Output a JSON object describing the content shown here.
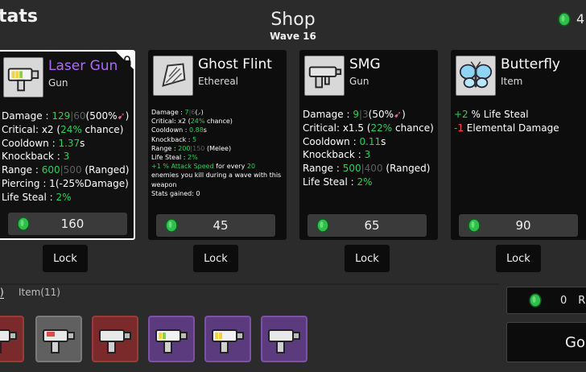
{
  "header": {
    "stats_label": "tats",
    "title": "Shop",
    "wave": "Wave 16",
    "coins": "4"
  },
  "colors": {
    "background": "#2b2b2b",
    "card": "#0d0d0d",
    "stat_green": "#29d05a",
    "stat_red": "#ff4a4a",
    "legendary_name": "#b366ff",
    "coin": "#2fbf4a"
  },
  "cards": [
    {
      "name": "Laser Gun",
      "type": "Gun",
      "icon": "laser-gun-icon",
      "selected": true,
      "locked": true,
      "price": "160",
      "lock_label": "Lock",
      "stats": {
        "damage_label": "Damage : ",
        "damage_value": "129",
        "damage_sep": "|",
        "damage_base": "60",
        "damage_scale": "(500%",
        "damage_scale_close": ")",
        "critical_label": "Critical: x2 (",
        "critical_pct": "24%",
        "critical_suffix": " chance)",
        "cooldown_label": "Cooldown : ",
        "cooldown_value": "1.37",
        "cooldown_unit": "s",
        "knockback_label": "Knockback : ",
        "knockback_value": "3",
        "range_label": "Range : ",
        "range_value": "600",
        "range_sep": "|",
        "range_base": "500",
        "range_suffix": " (Ranged)",
        "piercing_label": "Piercing : 1(-25%Damage)",
        "lifesteal_label": "Life Steal : ",
        "lifesteal_value": "2%"
      }
    },
    {
      "name": "Ghost Flint",
      "type": "Ethereal",
      "icon": "ghost-flint-icon",
      "price": "45",
      "lock_label": "Lock",
      "stats": {
        "damage_label": "Damage : ",
        "damage_value": "7",
        "damage_sep": "|",
        "damage_base": "6",
        "damage_scale": "(",
        "damage_scale_close": ")",
        "critical_label": "Critical: x2 (",
        "critical_pct": "24%",
        "critical_suffix": " chance)",
        "cooldown_label": "Cooldown : ",
        "cooldown_value": "0.88",
        "cooldown_unit": "s",
        "knockback_label": "Knockback : ",
        "knockback_value": "5",
        "range_label": "Range : ",
        "range_value": "200",
        "range_sep": "|",
        "range_base": "150",
        "range_suffix": " (Melee)",
        "lifesteal_label": "Life Steal : ",
        "lifesteal_value": "2%",
        "special_green": "+1 % Attack Speed",
        "special_text": " for every ",
        "special_num": "20",
        "special_rest": " enemies you kill during a wave with this weapon",
        "stats_gained": "Stats gained: 0"
      }
    },
    {
      "name": "SMG",
      "type": "Gun",
      "icon": "smg-icon",
      "price": "65",
      "lock_label": "Lock",
      "stats": {
        "damage_label": "Damage : ",
        "damage_value": "9",
        "damage_sep": "|",
        "damage_base": "3",
        "damage_scale": "(50%",
        "damage_scale_close": ")",
        "critical_label": "Critical: x1.5 (",
        "critical_pct": "22%",
        "critical_suffix": " chance)",
        "cooldown_label": "Cooldown : ",
        "cooldown_value": "0.11",
        "cooldown_unit": "s",
        "knockback_label": "Knockback : ",
        "knockback_value": "3",
        "range_label": "Range : ",
        "range_value": "500",
        "range_sep": "|",
        "range_base": "400",
        "range_suffix": " (Ranged)",
        "lifesteal_label": "Life Steal : ",
        "lifesteal_value": "2%"
      }
    },
    {
      "name": "Butterfly",
      "type": "Item",
      "icon": "butterfly-icon",
      "price": "90",
      "lock_label": "Lock",
      "stats": {
        "line1_green": "+2",
        "line1_text": " % Life Steal",
        "line2_red": "-1",
        "line2_text": " Elemental Damage"
      }
    }
  ],
  "bottom": {
    "tab_weapons": ")",
    "tab_items": "Item(11)",
    "inventory": [
      {
        "icon": "gun-icon",
        "tier": "red"
      },
      {
        "icon": "gun-icon",
        "tier": "gray"
      },
      {
        "icon": "gun-icon",
        "tier": "red"
      },
      {
        "icon": "laser-gun-icon",
        "tier": "purple"
      },
      {
        "icon": "laser-gun-icon",
        "tier": "purple"
      },
      {
        "icon": "gun-icon",
        "tier": "purple"
      }
    ],
    "reroll_value": "0",
    "reroll_label": "R",
    "go_label": "Go"
  }
}
